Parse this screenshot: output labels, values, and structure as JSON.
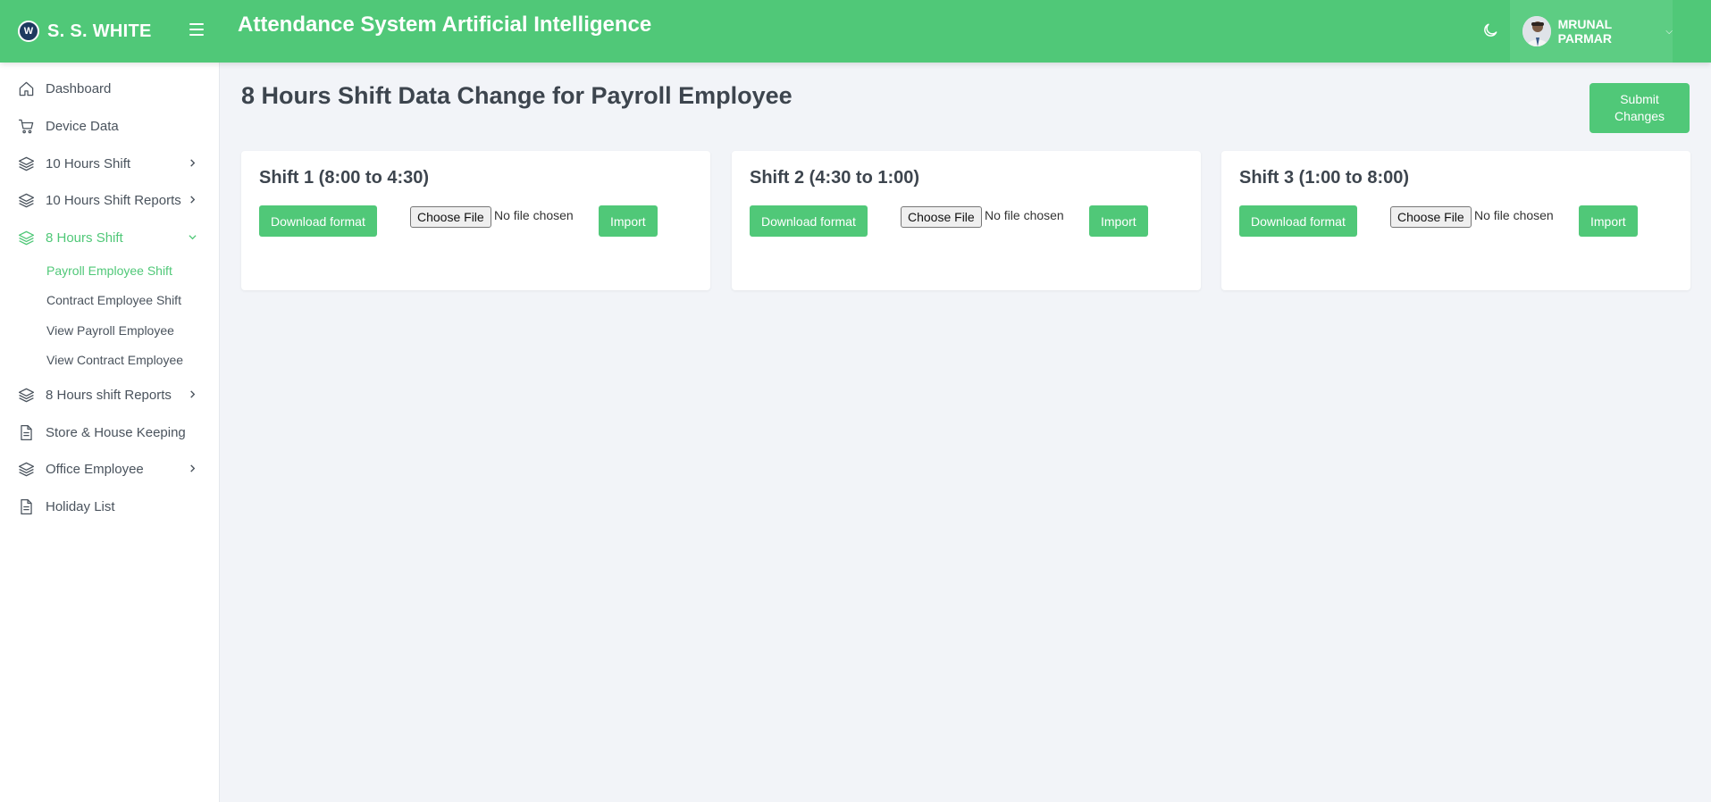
{
  "app": {
    "brand_mark": "W",
    "brand_name": "S. S. WHITE",
    "title": "Attendance System Artificial Intelligence"
  },
  "user": {
    "name": "MRUNAL PARMAR",
    "avatar_icon": "user-avatar"
  },
  "theme": {
    "accent": "#50c878",
    "accent_light": "#5dcd83",
    "background": "#f2f4f8",
    "text": "#444c55"
  },
  "sidebar": {
    "items": [
      {
        "label": "Dashboard",
        "icon": "home-icon"
      },
      {
        "label": "Device Data",
        "icon": "cart-icon"
      },
      {
        "label": "10 Hours Shift",
        "icon": "layers-icon",
        "expandable": true
      },
      {
        "label": "10 Hours Shift Reports",
        "icon": "layers-icon",
        "expandable": true
      },
      {
        "label": "8 Hours Shift",
        "icon": "layers-icon",
        "expandable": true,
        "expanded": true,
        "active": true
      },
      {
        "label": "8 Hours shift Reports",
        "icon": "layers-icon",
        "expandable": true
      },
      {
        "label": "Store & House Keeping",
        "icon": "document-icon"
      },
      {
        "label": "Office Employee",
        "icon": "layers-icon",
        "expandable": true
      },
      {
        "label": "Holiday List",
        "icon": "document-icon"
      }
    ],
    "sub_items": [
      {
        "label": "Payroll Employee Shift",
        "active": true
      },
      {
        "label": "Contract Employee Shift"
      },
      {
        "label": "View Payroll Employee"
      },
      {
        "label": "View Contract Employee"
      }
    ]
  },
  "main": {
    "page_title": "8 Hours Shift Data Change for Payroll Employee",
    "submit_label": "Submit Changes",
    "cards": [
      {
        "title": "Shift 1 (8:00 to 4:30)",
        "download_label": "Download format",
        "file_button": "Choose File",
        "file_status": "No file chosen",
        "import_label": "Import"
      },
      {
        "title": "Shift 2 (4:30 to 1:00)",
        "download_label": "Download format",
        "file_button": "Choose File",
        "file_status": "No file chosen",
        "import_label": "Import"
      },
      {
        "title": "Shift 3 (1:00 to 8:00)",
        "download_label": "Download format",
        "file_button": "Choose File",
        "file_status": "No file chosen",
        "import_label": "Import"
      }
    ]
  }
}
